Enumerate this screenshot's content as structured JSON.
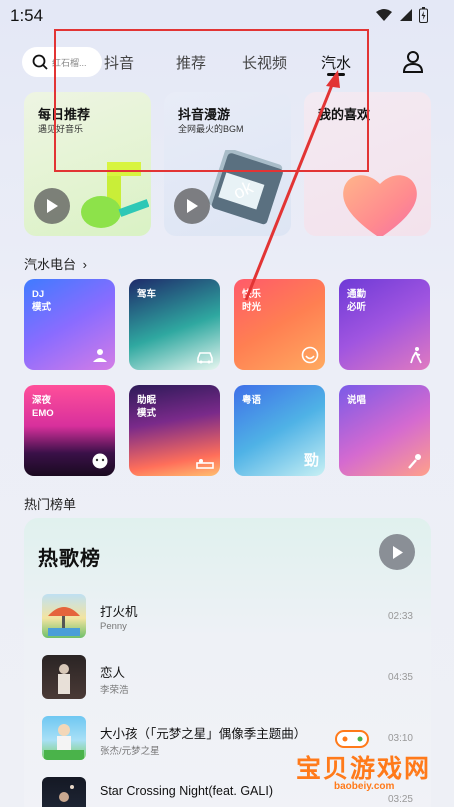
{
  "status_bar": {
    "time": "1:54"
  },
  "top_nav": {
    "search_placeholder": "红石榴...",
    "tabs": [
      {
        "label": "抖音"
      },
      {
        "label": "推荐"
      },
      {
        "label": "长视频"
      },
      {
        "label": "汽水"
      }
    ],
    "active_tab": "汽水"
  },
  "feature_cards": [
    {
      "title": "每日推荐",
      "subtitle": "遇见好音乐"
    },
    {
      "title": "抖音漫游",
      "subtitle": "全网最火的BGM"
    },
    {
      "title": "我的喜欢",
      "subtitle": ""
    }
  ],
  "radio": {
    "title": "汽水电台",
    "chevron": "›",
    "stations": [
      {
        "label": "DJ\n模式",
        "icon": "dj-icon"
      },
      {
        "label": "驾车",
        "icon": "car-icon"
      },
      {
        "label": "快乐\n时光",
        "icon": "smile-icon"
      },
      {
        "label": "通勤\n必听",
        "icon": "walk-icon"
      },
      {
        "label": "深夜\nEMO",
        "icon": "emo-icon"
      },
      {
        "label": "助眠\n模式",
        "icon": "sleep-icon"
      },
      {
        "label": "粤语",
        "icon": "cantonese-icon"
      },
      {
        "label": "说唱",
        "icon": "rap-icon"
      }
    ]
  },
  "charts": {
    "section_title": "热门榜单",
    "panel_title": "热歌榜",
    "songs": [
      {
        "title": "打火机",
        "artist": "Penny",
        "duration": "02:33"
      },
      {
        "title": "恋人",
        "artist": "李荣浩",
        "duration": "04:35"
      },
      {
        "title": "大小孩（「元梦之星」偶像季主题曲）",
        "artist": "张杰/元梦之星",
        "duration": "03:10"
      },
      {
        "title": "Star Crossing Night(feat. GALI)",
        "artist": "",
        "duration": "03:25"
      }
    ]
  },
  "watermark": {
    "text": "宝贝游戏网",
    "url": "baobeiy.com"
  },
  "colors": {
    "annotation": "#e23434",
    "watermark": "#ff7a1a"
  }
}
